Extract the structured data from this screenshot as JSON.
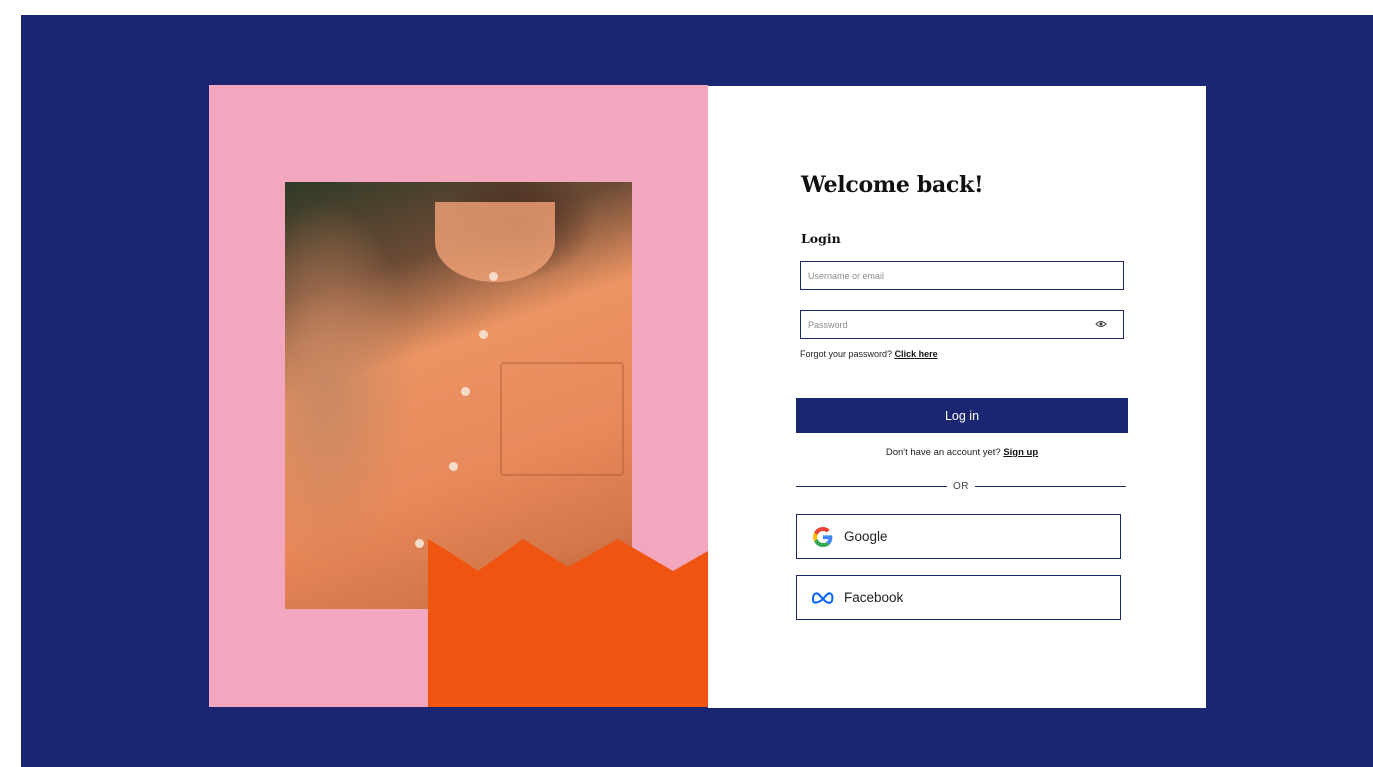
{
  "page": {
    "colors": {
      "backdrop": "#1b2672",
      "panel_pink": "#f2a7be",
      "accent_orange": "#ef5410",
      "primary_navy": "#1b2672"
    }
  },
  "login": {
    "title": "Welcome back!",
    "subtitle": "Login",
    "username_placeholder": "Username or email",
    "password_placeholder": "Password",
    "password_toggle_icon": "eye-icon",
    "forgot_text": "Forgot your password?",
    "forgot_link": "Click here",
    "submit_label": "Log in",
    "signup_text": "Don't have an account yet?",
    "signup_link": "Sign up",
    "divider_text": "OR"
  },
  "social": [
    {
      "label": "Google",
      "icon": "google-icon"
    },
    {
      "label": "Facebook",
      "icon": "meta-icon"
    }
  ]
}
